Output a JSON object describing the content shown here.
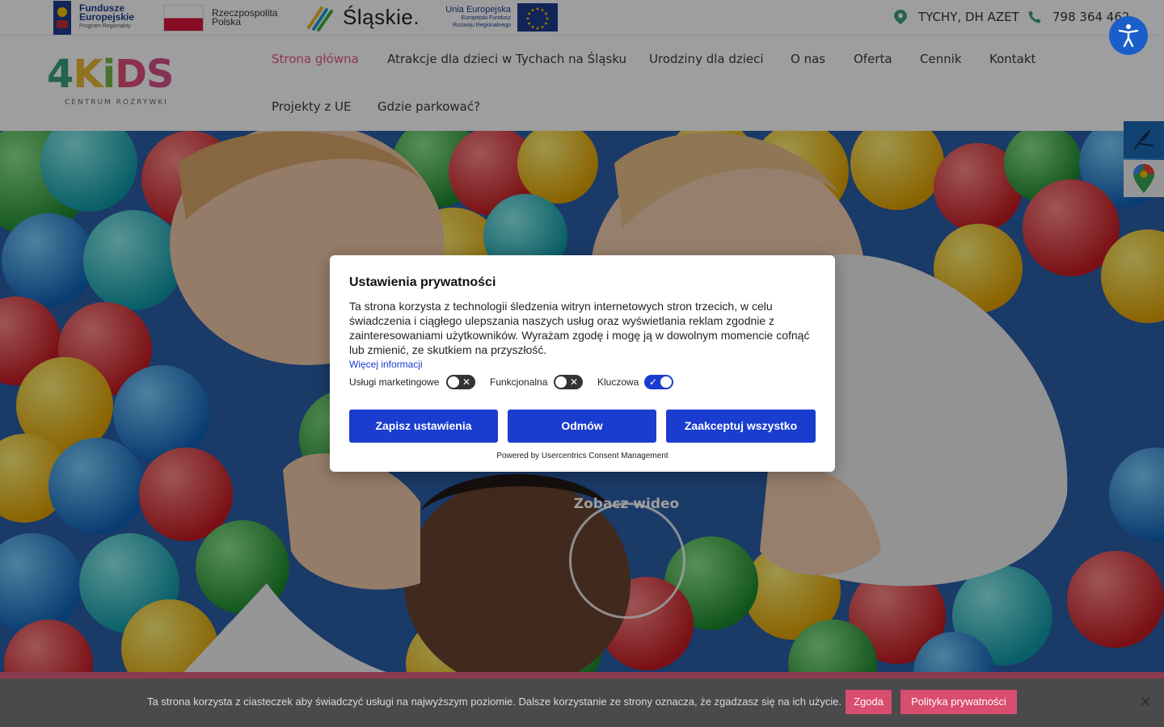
{
  "topbar": {
    "fe_logo": {
      "line1": "Fundusze",
      "line2": "Europejskie",
      "sub": "Program Regionalny"
    },
    "pl_logo": {
      "line1": "Rzeczpospolita",
      "line2": "Polska"
    },
    "sl_logo": {
      "text": "Śląskie."
    },
    "eu_logo": {
      "line1": "Unia Europejska",
      "line2": "Europejski Fundusz",
      "line3": "Rozwoju Regionalnego"
    },
    "location": "TYCHY, DH AZET",
    "phone": "798 364 462"
  },
  "brand": {
    "letter4": "4",
    "letterK": "K",
    "letterI": "i",
    "letterD": "D",
    "letterS": "S",
    "tagline": "CENTRUM ROZRYWKI"
  },
  "nav": [
    {
      "label": "Strona główna",
      "active": true
    },
    {
      "label": "Atrakcje dla dzieci w Tychach na Śląsku"
    },
    {
      "label": "Urodziny dla dzieci"
    },
    {
      "label": "O nas"
    },
    {
      "label": "Oferta"
    },
    {
      "label": "Cennik"
    },
    {
      "label": "Kontakt"
    },
    {
      "label": "Projekty z UE"
    },
    {
      "label": "Gdzie parkować?"
    }
  ],
  "hero": {
    "video_label": "Zobacz wideo"
  },
  "privacy_modal": {
    "title": "Ustawienia prywatności",
    "body": "Ta strona korzysta z technologii śledzenia witryn internetowych stron trzecich, w celu świadczenia i ciągłego ulepszania naszych usług oraz wyświetlania reklam zgodnie z zainteresowaniami użytkowników. Wyrażam zgodę i mogę ją w dowolnym momencie cofnąć lub zmienić, ze skutkiem na przyszłość.",
    "more_link": "Więcej informacji",
    "toggles": [
      {
        "label": "Usługi marketingowe",
        "on": false
      },
      {
        "label": "Funkcjonalna",
        "on": false
      },
      {
        "label": "Kluczowa",
        "on": true
      }
    ],
    "buttons": {
      "save": "Zapisz ustawienia",
      "decline": "Odmów",
      "accept_all": "Zaakceptuj wszystko"
    },
    "powered_by": "Powered by Usercentrics Consent Management"
  },
  "cookie_bar": {
    "text": "Ta strona korzysta z ciasteczek aby świadczyć usługi na najwyższym poziomie. Dalsze korzystanie ze strony oznacza, że zgadzasz się na ich użycie.",
    "accept": "Zgoda",
    "policy": "Polityka prywatności"
  },
  "colors": {
    "accent_pink": "#e45a7e",
    "modal_blue": "#1a3ccf",
    "a11y_blue": "#1a5fc9",
    "cookie_bg": "#4a4a4a"
  }
}
